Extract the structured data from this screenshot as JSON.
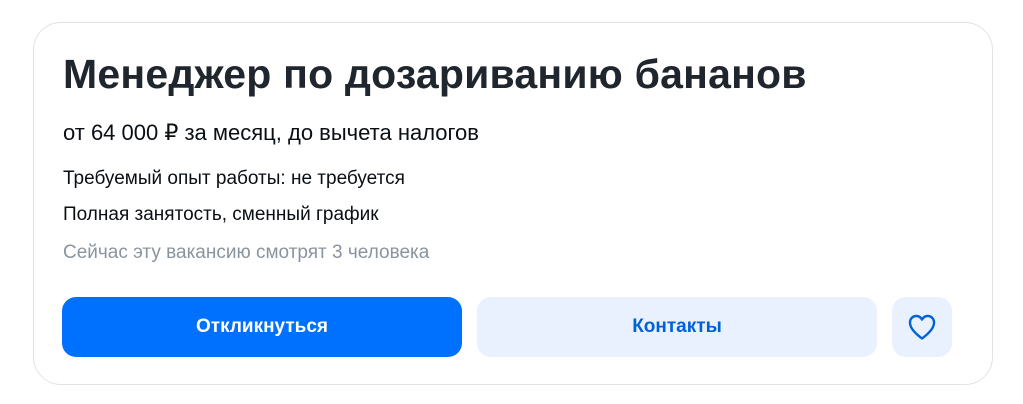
{
  "vacancy": {
    "title": "Менеджер по дозариванию бананов",
    "salary": "от 64 000 ₽ за месяц, до вычета налогов",
    "experience": "Требуемый опыт работы: не требуется",
    "employment": "Полная занятость, сменный график",
    "watching": "Сейчас эту вакансию смотрят 3 человека"
  },
  "actions": {
    "respond_label": "Откликнуться",
    "contacts_label": "Контакты",
    "favorite_icon": "heart-icon"
  },
  "colors": {
    "primary": "#0070ff",
    "secondary_bg": "#e8f1fd",
    "secondary_text": "#0062d9",
    "muted_text": "#8a949f",
    "title_text": "#20262d"
  }
}
